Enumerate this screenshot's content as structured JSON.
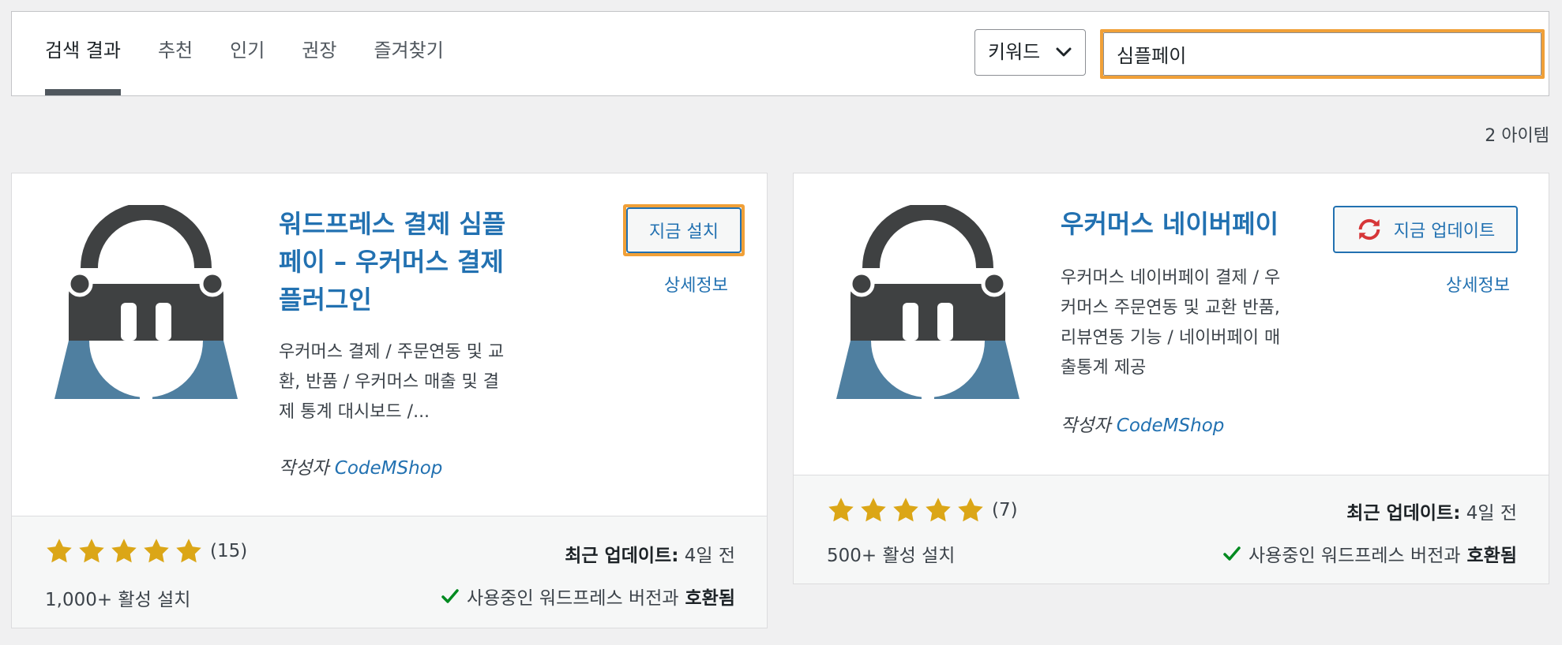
{
  "filter": {
    "tabs": [
      {
        "label": "검색 결과",
        "current": true
      },
      {
        "label": "추천",
        "current": false
      },
      {
        "label": "인기",
        "current": false
      },
      {
        "label": "권장",
        "current": false
      },
      {
        "label": "즐겨찾기",
        "current": false
      }
    ],
    "search_type": "키워드",
    "search_value": "심플페이"
  },
  "item_count": "2 아이템",
  "colors": {
    "accent": "#2271b1",
    "focus_outline": "#f0a038",
    "icon_dark": "#3f4142",
    "icon_blue": "#4f7fa0",
    "star": "#dba617",
    "check": "#00a32a",
    "update_icon": "#d63638"
  },
  "plugins": [
    {
      "title_lines": [
        "워드프레스 결제 심플",
        "페이 – 우커머스 결제",
        "플러그인"
      ],
      "description_lines": [
        "우커머스 결제 / 주문연동 및 교",
        "환, 반품 / 우커머스 매출 및 결",
        "제 통계 대시보드 /..."
      ],
      "author_label": "작성자",
      "author": "CodeMShop",
      "action_label": "지금 설치",
      "action_icon": null,
      "more_label": "상세정보",
      "rating_stars": 5,
      "rating_count": "(15)",
      "installs": "1,000+ 활성 설치",
      "updated_label": "최근 업데이트:",
      "updated_value": "4일 전",
      "compat_text": "사용중인 워드프레스 버전과",
      "compat_strong": "호환됨"
    },
    {
      "title_lines": [
        "우커머스 네이버페이"
      ],
      "description_lines": [
        "우커머스 네이버페이 결제 / 우",
        "커머스 주문연동 및 교환 반품,",
        "리뷰연동 기능 / 네이버페이 매",
        "출통계 제공"
      ],
      "author_label": "작성자",
      "author": "CodeMShop",
      "action_label": "지금 업데이트",
      "action_icon": "update-icon",
      "more_label": "상세정보",
      "rating_stars": 5,
      "rating_count": "(7)",
      "installs": "500+ 활성 설치",
      "updated_label": "최근 업데이트:",
      "updated_value": "4일 전",
      "compat_text": "사용중인 워드프레스 버전과",
      "compat_strong": "호환됨"
    }
  ]
}
